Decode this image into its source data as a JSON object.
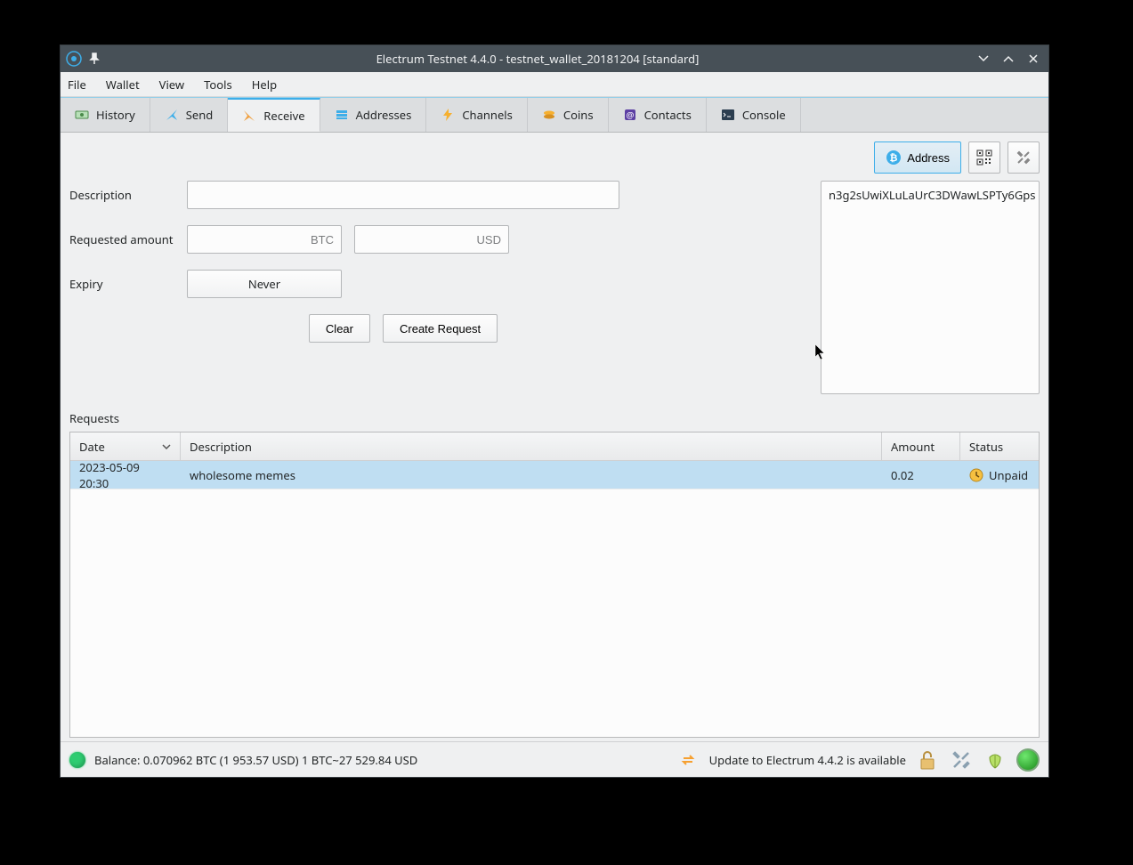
{
  "window": {
    "title": "Electrum Testnet 4.4.0 - testnet_wallet_20181204 [standard]"
  },
  "menu": {
    "file": "File",
    "wallet": "Wallet",
    "view": "View",
    "tools": "Tools",
    "help": "Help"
  },
  "tabs": {
    "history": "History",
    "send": "Send",
    "receive": "Receive",
    "addresses": "Addresses",
    "channels": "Channels",
    "coins": "Coins",
    "contacts": "Contacts",
    "console": "Console"
  },
  "form": {
    "description_label": "Description",
    "description_value": "",
    "requested_amount_label": "Requested amount",
    "btc_placeholder": "BTC",
    "btc_value": "",
    "usd_placeholder": "USD",
    "usd_value": "",
    "expiry_label": "Expiry",
    "expiry_value": "Never",
    "clear_button": "Clear",
    "create_button": "Create Request"
  },
  "right": {
    "address_button": "Address",
    "address_value": "n3g2sUwiXLuLaUrC3DWawLSPTy6Gps"
  },
  "requests": {
    "label": "Requests",
    "headers": {
      "date": "Date",
      "description": "Description",
      "amount": "Amount",
      "status": "Status"
    },
    "rows": [
      {
        "date": "2023-05-09 20:30",
        "description": "wholesome memes",
        "amount": "0.02",
        "status": "Unpaid"
      }
    ]
  },
  "statusbar": {
    "balance": "Balance: 0.070962 BTC (1 953.57 USD)  1 BTC~27 529.84 USD",
    "update": "Update to Electrum 4.4.2 is available"
  }
}
